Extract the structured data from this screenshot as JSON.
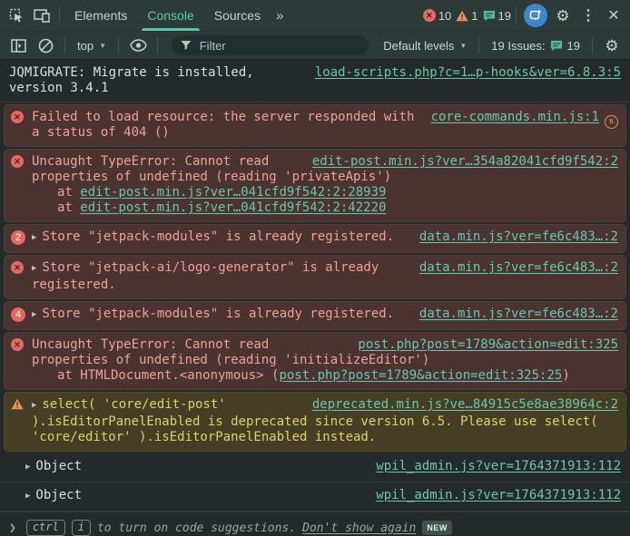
{
  "tabs_bar": {
    "tabs": [
      {
        "label": "Elements",
        "active": false
      },
      {
        "label": "Console",
        "active": true
      },
      {
        "label": "Sources",
        "active": false
      }
    ],
    "more_tabs_chevron": "»",
    "error_count": "10",
    "warning_count": "1",
    "message_count": "19"
  },
  "console_toolbar": {
    "context_selector": "top",
    "filter_placeholder": "Filter",
    "levels_dropdown": "Default levels",
    "issues_text": "19 Issues:",
    "issues_count": "19"
  },
  "messages": [
    {
      "level": "log",
      "text": "JQMIGRATE: Migrate is installed, version 3.4.1",
      "link": "load-scripts.php?c=1…p-hooks&ver=6.8.3:5"
    },
    {
      "level": "error",
      "icon": "error-icon",
      "text": "Failed to load resource: the server responded with a status of 404 ()",
      "link": "core-commands.min.js:1",
      "link_icon": "network-request-icon"
    },
    {
      "level": "error",
      "icon": "error-icon",
      "text": "Uncaught TypeError: Cannot read properties of undefined (reading 'privateApis')",
      "link": "edit-post.min.js?ver…354a82041cfd9f542:2",
      "stack": [
        {
          "prefix": "at ",
          "link": "edit-post.min.js?ver…041cfd9f542:2:28939",
          "suffix": ""
        },
        {
          "prefix": "at ",
          "link": "edit-post.min.js?ver…041cfd9f542:2:42220",
          "suffix": ""
        }
      ]
    },
    {
      "level": "error",
      "icon": "repeat-count-badge",
      "badge": "2",
      "expandable": true,
      "text": "Store \"jetpack-modules\" is already registered.",
      "link": "data.min.js?ver=fe6c483…:2"
    },
    {
      "level": "error",
      "icon": "error-icon",
      "expandable": true,
      "text": "Store \"jetpack-ai/logo-generator\" is already registered.",
      "link": "data.min.js?ver=fe6c483…:2"
    },
    {
      "level": "error",
      "icon": "repeat-count-badge",
      "badge": "4",
      "expandable": true,
      "text": "Store \"jetpack-modules\" is already registered.",
      "link": "data.min.js?ver=fe6c483…:2"
    },
    {
      "level": "error",
      "icon": "error-icon",
      "text": "Uncaught TypeError: Cannot read properties of undefined (reading 'initializeEditor')",
      "link": "post.php?post=1789&action=edit:325",
      "stack": [
        {
          "prefix": "at HTMLDocument.<anonymous> (",
          "link": "post.php?post=1789&action=edit:325:25",
          "suffix": ")"
        }
      ]
    },
    {
      "level": "warning",
      "icon": "warning-icon",
      "expandable": true,
      "text": "select( 'core/edit-post' ).isEditorPanelEnabled is deprecated since version 6.5. Please use select( 'core/editor' ).isEditorPanelEnabled instead.",
      "link": "deprecated.min.js?ve…84915c5e8ae38964c:2"
    },
    {
      "level": "log",
      "expandable": true,
      "indent": true,
      "text": "Object",
      "link": "wpil_admin.js?ver=1764371913:112"
    },
    {
      "level": "log",
      "expandable": true,
      "indent": true,
      "text": "Object",
      "link": "wpil_admin.js?ver=1764371913:112"
    }
  ],
  "prompt": {
    "chevron": "❯",
    "keys": [
      "ctrl",
      "i"
    ],
    "hint": "to turn on code suggestions.",
    "dismiss_link": "Don't show again",
    "new_badge": "NEW"
  },
  "colors": {
    "accent": "#5fc4af",
    "link": "#6cc7b2",
    "error_bg": "#4a3330",
    "error_text": "#f0a298",
    "error_icon_bg": "#e46962",
    "warning_bg": "#453e24",
    "warning_text": "#dcd36e",
    "warning_icon": "#e8935c",
    "toolbar_bg": "#2d3b38",
    "console_bg": "#242a29",
    "text": "#d9e0dc",
    "muted": "#9aa5a0",
    "blue_button": "#3d87cc"
  }
}
